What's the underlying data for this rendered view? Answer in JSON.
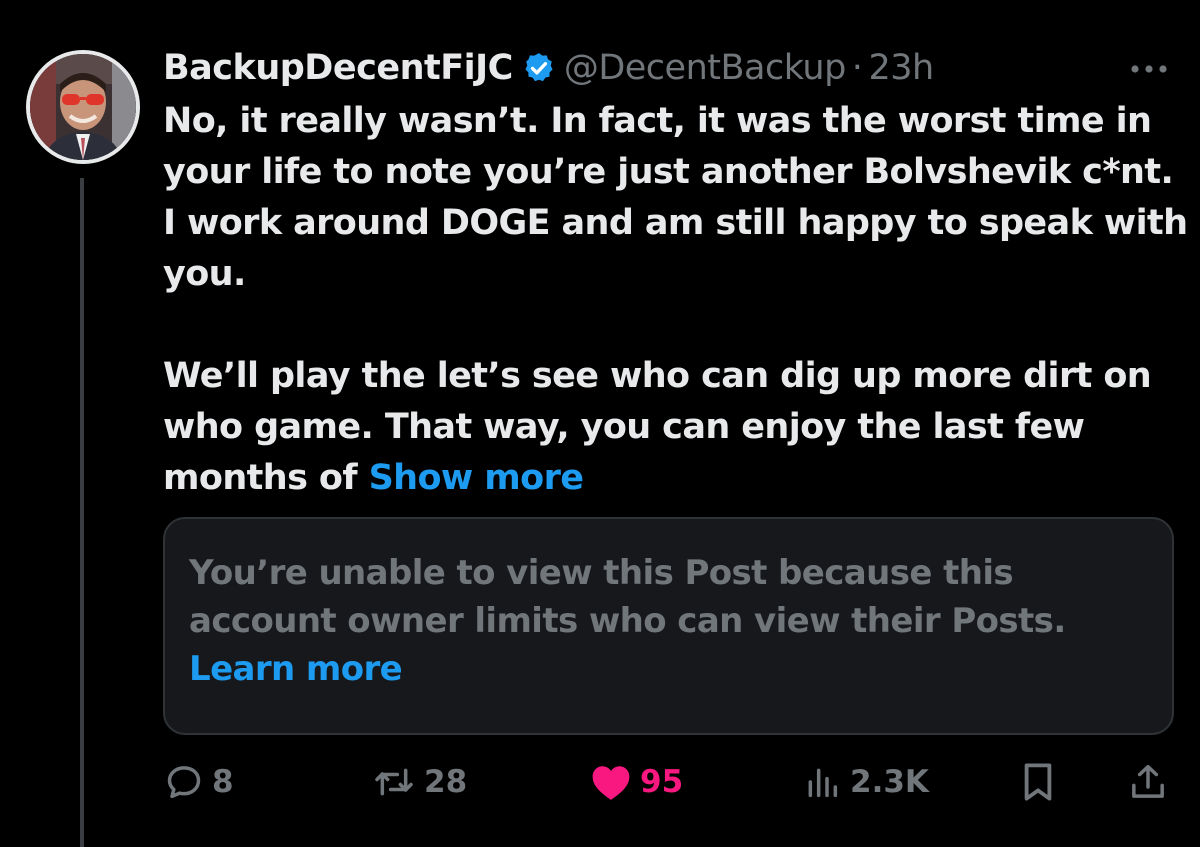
{
  "post": {
    "author": {
      "display_name": "BackupDecentFiJC",
      "handle": "@DecentBackup",
      "separator": "·",
      "time": "23h",
      "verified": true
    },
    "text": {
      "paragraph1": "No, it really wasn’t. In fact, it was the worst time in your life to note you’re just another Bolvshevik c*nt. I work around DOGE and am still happy to speak with you.",
      "paragraph2": "We’ll play the let’s see who can dig up more dirt on who game. That way, you can enjoy the last few months of ",
      "show_more": "Show more"
    },
    "quoted_post": {
      "notice": "You’re unable to view this Post because this account owner limits who can view their Posts.",
      "learn_more": "Learn more"
    },
    "actions": {
      "replies": "8",
      "reposts": "28",
      "likes": "95",
      "liked": true,
      "views": "2.3K"
    }
  },
  "icons": {
    "verified": "verified-badge-icon",
    "more": "more-options-icon",
    "reply": "reply-bubble-icon",
    "repost": "repost-arrows-icon",
    "like": "heart-icon",
    "views": "views-bar-chart-icon",
    "bookmark": "bookmark-icon",
    "share": "share-upload-icon"
  },
  "colors": {
    "background": "#000000",
    "text_primary": "#e7e9ea",
    "text_secondary": "#71767b",
    "link": "#1d9bf0",
    "like_active": "#f91880",
    "card_background": "#16181c",
    "card_border": "#2f3336"
  }
}
